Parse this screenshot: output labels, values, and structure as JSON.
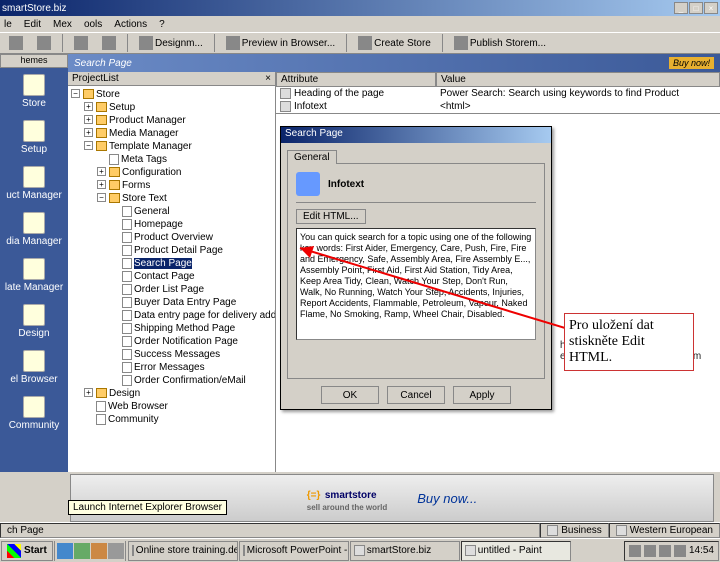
{
  "window": {
    "title": "smartStore.biz"
  },
  "menu": [
    "le",
    "Edit",
    "Mex",
    "ools",
    "Actions",
    "?"
  ],
  "toolbar": [
    {
      "label": "Designm..."
    },
    {
      "label": "Preview in Browser..."
    },
    {
      "label": "Create Store"
    },
    {
      "label": "Publish Storem..."
    }
  ],
  "sidebar": {
    "tab": "hemes",
    "items": [
      "Store",
      "Setup",
      "uct Manager",
      "dia Manager",
      "late Manager",
      "Design",
      "el Browser",
      "Community"
    ]
  },
  "content": {
    "title": "Search Page",
    "buynow": "Buy now!"
  },
  "treehdr": "ProjectList",
  "tree": {
    "root": "Store",
    "items": [
      "Setup",
      "Product Manager",
      "Media Manager",
      "Template Manager"
    ],
    "tm": [
      "Meta Tags",
      "Configuration",
      "Forms",
      "Store Text"
    ],
    "st": [
      "General",
      "Homepage",
      "Product Overview",
      "Product Detail Page",
      "Search Page",
      "Contact Page",
      "Order List Page",
      "Buyer Data Entry Page",
      "Data entry page for delivery address",
      "Shipping Method Page",
      "Order Notification Page",
      "Success Messages",
      "Error Messages",
      "Order Confirmation/eMail"
    ],
    "after": [
      "Design",
      "Web Browser",
      "Community"
    ]
  },
  "attr": {
    "hAttr": "Attribute",
    "hVal": "Value",
    "r1a": "Heading of the page",
    "r1v": "Power Search: Search using keywords to find Product",
    "r2a": "Infotext",
    "r2v": "<html>"
  },
  "dialog": {
    "title": "Search Page",
    "tab": "General",
    "info": "Infotext",
    "editbtn": "Edit HTML...",
    "text": "You can quick search for a topic using one of the following key words: First Aider, Emergency, Care, Push, Fire, Fire and Emergency, Safe, Assembly Area, Fire Assembly E..., Assembly Point, First Aid, First Aid Station, Tidy Area, Keep Area Tidy, Clean, Watch Your Step, Don't Run, Walk, No Running, Watch Your Step, Accidents, Injuries, Report Accidents, Flammable, Petroleum, Vapour, Naked Flame, No Smoking, Ramp, Wheel Chair, Disabled.",
    "ok": "OK",
    "cancel": "Cancel",
    "apply": "Apply"
  },
  "help": {
    "l1": "h Please try again.",
    "l2": "e Please enter your search item"
  },
  "callout": "Pro uložení dat stiskněte Edit HTML.",
  "banner": {
    "brand": "smartstore",
    "tag": "sell around the world",
    "buy": "Buy now..."
  },
  "status": {
    "left": "ch Page",
    "mid": "Business",
    "enc": "Western European"
  },
  "taskbar": {
    "start": "Start",
    "tooltip": "Launch Internet Explorer Browser",
    "tasks": [
      "Online store training.dev",
      "Microsoft PowerPoint - ...",
      "smartStore.biz",
      "untitled - Paint"
    ]
  },
  "clock": "14:54"
}
